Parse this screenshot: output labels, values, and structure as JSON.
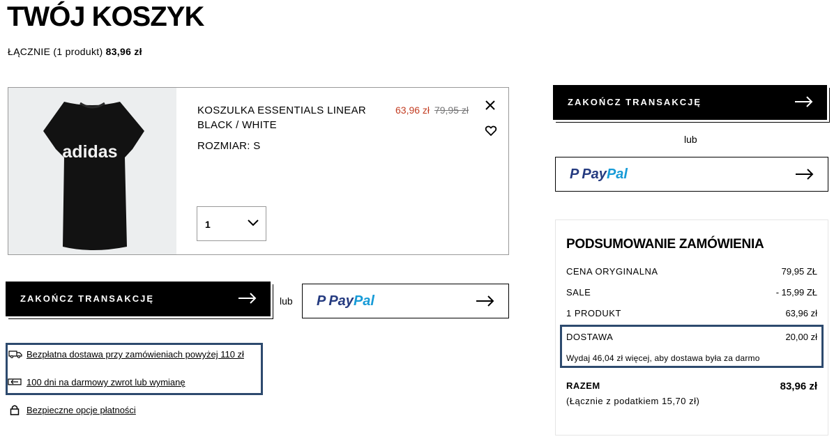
{
  "page": {
    "title": "TWÓJ KOSZYK",
    "total_prefix": "ŁĄCZNIE (1 produkt)",
    "total_value": "83,96 zł"
  },
  "item": {
    "name": "KOSZULKA ESSENTIALS LINEAR BLACK / WHITE",
    "size": "ROZMIAR: S",
    "sale_price": "63,96 zł",
    "original_price": "79,95 zł",
    "quantity": "1",
    "image_logo_text": "adidas"
  },
  "checkout": {
    "label": "ZAKOŃCZ TRANSAKCJĘ",
    "or": "lub",
    "paypal_pay": "Pay",
    "paypal_pal": "Pal"
  },
  "benefits": [
    {
      "text": "Bezpłatna dostawa przy zamówieniach powyżej 110 zł",
      "icon": "truck-icon"
    },
    {
      "text": "100 dni na darmowy zwrot lub wymianę",
      "icon": "return-icon"
    },
    {
      "text": "Bezpieczne opcje płatności",
      "icon": "lock-icon"
    }
  ],
  "summary": {
    "title": "PODSUMOWANIE ZAMÓWIENIA",
    "rows": [
      {
        "label": "CENA ORYGINALNA",
        "value": "79,95 ZŁ"
      },
      {
        "label": "SALE",
        "value": "- 15,99 ZŁ"
      },
      {
        "label": "1 PRODUKT",
        "value": "63,96 zł"
      },
      {
        "label": "DOSTAWA",
        "value": "20,00 zł"
      }
    ],
    "shipping_note": "Wydaj 46,04 zł więcej, aby dostawa była za darmo",
    "total_label": "RAZEM",
    "total_value": "83,96 zł",
    "tax_note": "(Łącznie z podatkiem  15,70 zł)"
  },
  "colors": {
    "sale": "#c33d22",
    "highlight_border": "#2d4a6e",
    "paypal_dark": "#253b80",
    "paypal_light": "#179bd7"
  }
}
